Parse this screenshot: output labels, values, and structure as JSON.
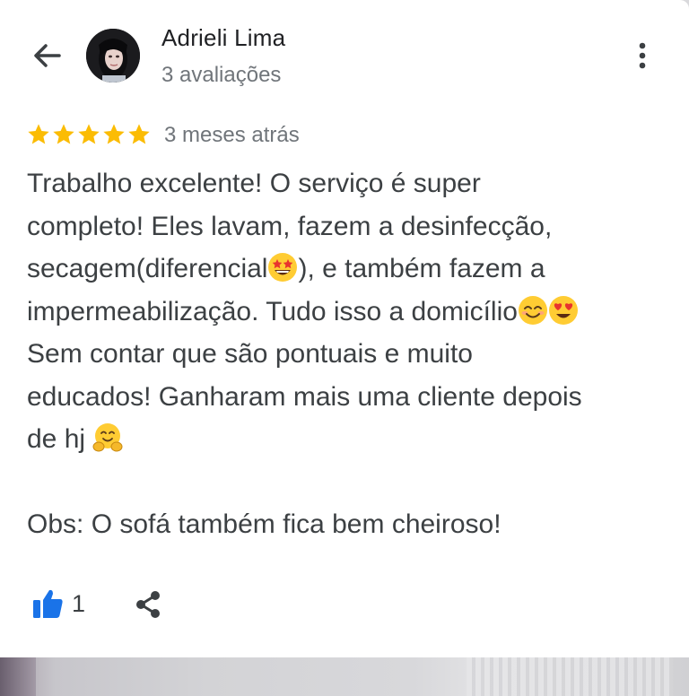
{
  "reviewer": {
    "name": "Adrieli Lima",
    "review_count": "3 avaliações"
  },
  "review": {
    "rating": 5,
    "max_rating": 5,
    "time_ago": "3 meses atrás",
    "text_part1": "Trabalho excelente! O serviço é super\ncompleto! Eles lavam, fazem a desinfecção,\nsecagem(diferencial",
    "text_part2": "), e também fazem a\nimpermeabilização. Tudo isso a domicílio",
    "text_part3": "\nSem contar que são pontuais e muito\neducados! Ganharam mais uma cliente depois\nde hj ",
    "text_part4": "\n\nObs: O sofá também fica bem cheiroso!",
    "likes": "1"
  },
  "icons": {
    "back": "arrow-left-icon",
    "more": "more-vertical-icon",
    "star": "star-icon",
    "like": "thumbs-up-icon",
    "share": "share-icon",
    "emoji_star_struck": "star-struck-emoji",
    "emoji_smiling": "smiling-eyes-emoji",
    "emoji_heart_eyes": "heart-eyes-emoji",
    "emoji_hugging": "hugging-emoji"
  },
  "colors": {
    "star": "#fbbc04",
    "like": "#1a73e8",
    "text": "#3c4043",
    "secondary": "#70757a"
  }
}
